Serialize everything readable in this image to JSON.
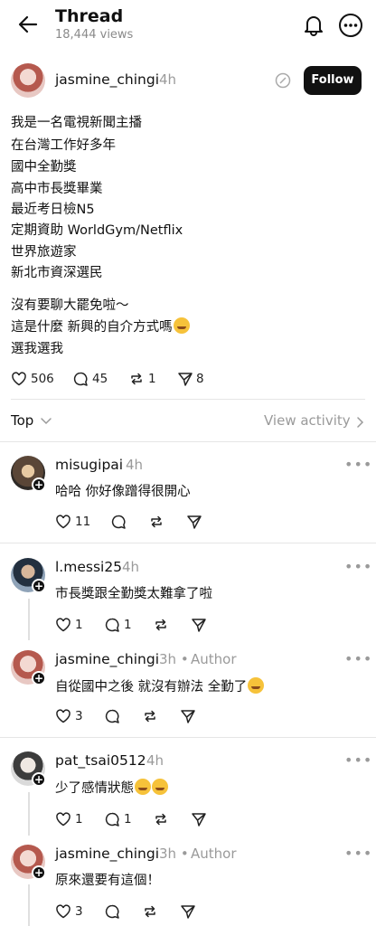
{
  "header": {
    "title": "Thread",
    "views": "18,444 views"
  },
  "post": {
    "username": "jasmine_chingi",
    "time": "4h",
    "follow_label": "Follow",
    "lines": [
      "我是一名電視新聞主播",
      "在台灣工作好多年",
      "國中全勤獎",
      "高中市長獎畢業",
      "最近考日檢N5",
      "定期資助 WorldGym/Netflix",
      "世界旅遊家",
      "新北市資深選民"
    ],
    "lines2": [
      "沒有要聊大罷免啦～",
      "這是什麼 新興的自介方式嗎",
      "選我選我"
    ],
    "likes": "506",
    "comments": "45",
    "reposts": "1",
    "shares": "8"
  },
  "sort": {
    "label": "Top",
    "view_activity": "View activity"
  },
  "replies": [
    {
      "username": "misugipai",
      "time": "4h",
      "text": "哈哈 你好像蹭得很開心",
      "likes": "11",
      "comments": "",
      "author": ""
    },
    {
      "username": "l.messi25",
      "time": "4h",
      "text": "市長獎跟全勤獎太難拿了啦",
      "likes": "1",
      "comments": "1",
      "author": ""
    },
    {
      "username": "jasmine_chingi",
      "time": "3h",
      "text": "自從國中之後 就沒有辦法 全勤了",
      "likes": "3",
      "comments": "",
      "author": "Author"
    },
    {
      "username": "pat_tsai0512",
      "time": "4h",
      "text": "少了感情狀態",
      "likes": "1",
      "comments": "1",
      "author": ""
    },
    {
      "username": "jasmine_chingi",
      "time": "3h",
      "text": "原來還要有這個！",
      "likes": "3",
      "comments": "",
      "author": "Author"
    }
  ],
  "icons": [
    "back-arrow-icon",
    "bell-icon",
    "more-icon",
    "heart-icon",
    "comment-icon",
    "repost-icon",
    "share-icon",
    "chevron-down-icon",
    "chevron-right-icon"
  ]
}
